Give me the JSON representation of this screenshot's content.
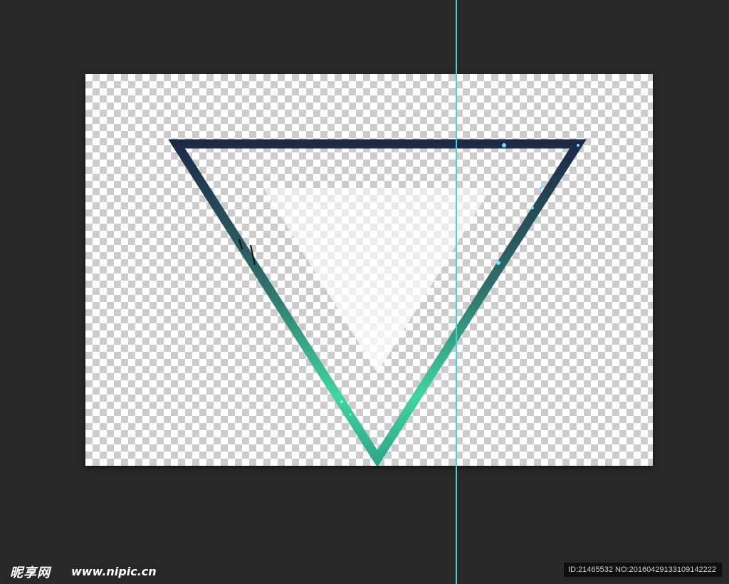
{
  "watermark": {
    "logo_text": "昵享网",
    "url_text": "www.nipic.cn",
    "id_text": "ID:21465532 NO:20160429133109142222"
  },
  "colors": {
    "background": "#282828",
    "guide_line": "#43d3dd",
    "triangle_top": "#1c2a48",
    "triangle_mid": "#3a8a78",
    "triangle_bottom": "#3fd6a0"
  },
  "icons": {
    "triangle": "inverted-triangle-outline",
    "inner": "white-triangle-fill"
  }
}
